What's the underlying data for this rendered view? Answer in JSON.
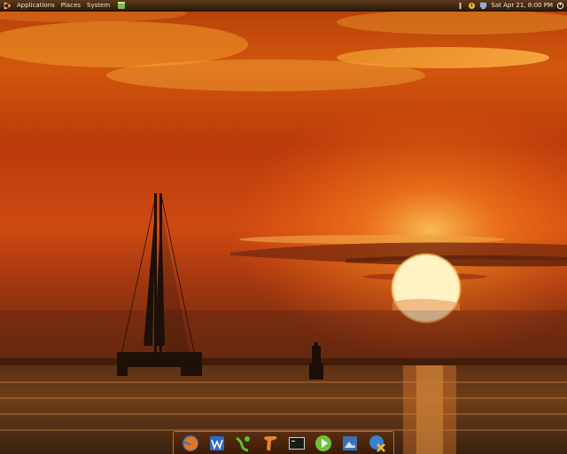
{
  "top_panel": {
    "menus": [
      {
        "label": "Applications"
      },
      {
        "label": "Places"
      },
      {
        "label": "System"
      }
    ],
    "clock": "Sat Apr 21,  8:00 PM",
    "tray_icons": [
      "network-manager-icon",
      "update-notifier-icon",
      "display-icon",
      "shutdown-icon"
    ]
  },
  "dock": {
    "items": [
      {
        "name": "firefox-icon"
      },
      {
        "name": "writer-icon"
      },
      {
        "name": "tux-paint-icon"
      },
      {
        "name": "scroll-app-icon"
      },
      {
        "name": "terminal-icon"
      },
      {
        "name": "media-play-icon"
      },
      {
        "name": "image-viewer-icon"
      },
      {
        "name": "chat-icon"
      }
    ]
  },
  "colors": {
    "panel": "#3d2410",
    "sky_top": "#a83a0c",
    "sun": "#fff0b0",
    "sea": "#4a2a12",
    "dock_border": "#c96a2a"
  }
}
